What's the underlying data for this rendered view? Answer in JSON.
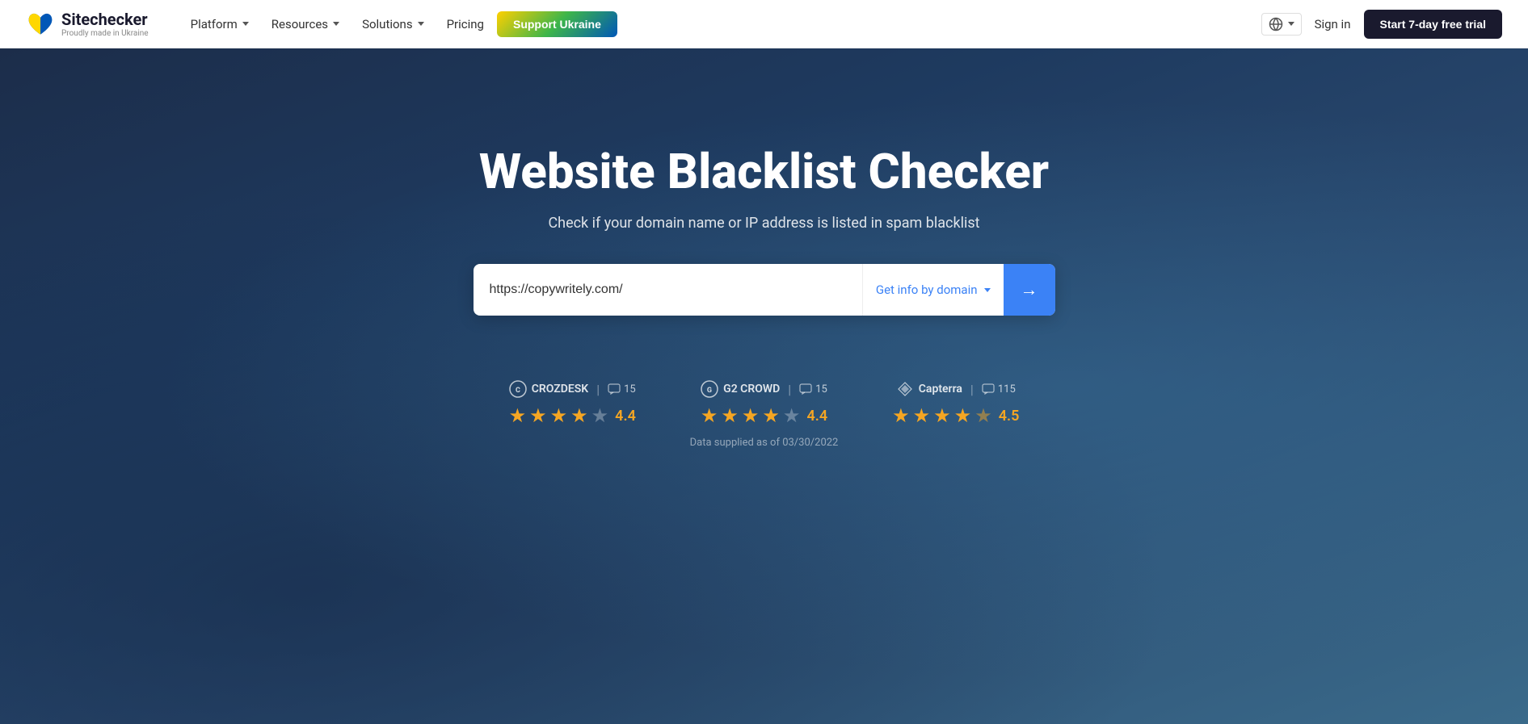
{
  "navbar": {
    "logo_name": "Sitechecker",
    "logo_tagline": "Proudly made in Ukraine",
    "nav_items": [
      {
        "label": "Platform",
        "has_dropdown": true
      },
      {
        "label": "Resources",
        "has_dropdown": true
      },
      {
        "label": "Solutions",
        "has_dropdown": true
      },
      {
        "label": "Pricing",
        "has_dropdown": false
      }
    ],
    "support_btn": "Support Ukraine",
    "globe_label": "",
    "signin_label": "Sign in",
    "trial_btn": "Start 7-day free trial"
  },
  "hero": {
    "title": "Website Blacklist Checker",
    "subtitle": "Check if your domain name or IP address is listed in spam blacklist",
    "search_placeholder": "https://copywritely.com/",
    "domain_selector_label": "Get info by domain",
    "submit_arrow": "→"
  },
  "ratings": [
    {
      "platform": "crozdesk",
      "platform_label": "CROZDESK",
      "review_count": "15",
      "score": "4.4",
      "full_stars": 3,
      "half_star": true,
      "empty_stars": 1
    },
    {
      "platform": "g2crowd",
      "platform_label": "G2 CROWD",
      "review_count": "15",
      "score": "4.4",
      "full_stars": 3,
      "half_star": true,
      "empty_stars": 1
    },
    {
      "platform": "capterra",
      "platform_label": "Capterra",
      "review_count": "115",
      "score": "4.5",
      "full_stars": 4,
      "half_star": true,
      "empty_stars": 0
    }
  ],
  "data_supplied_text": "Data supplied as of 03/30/2022"
}
